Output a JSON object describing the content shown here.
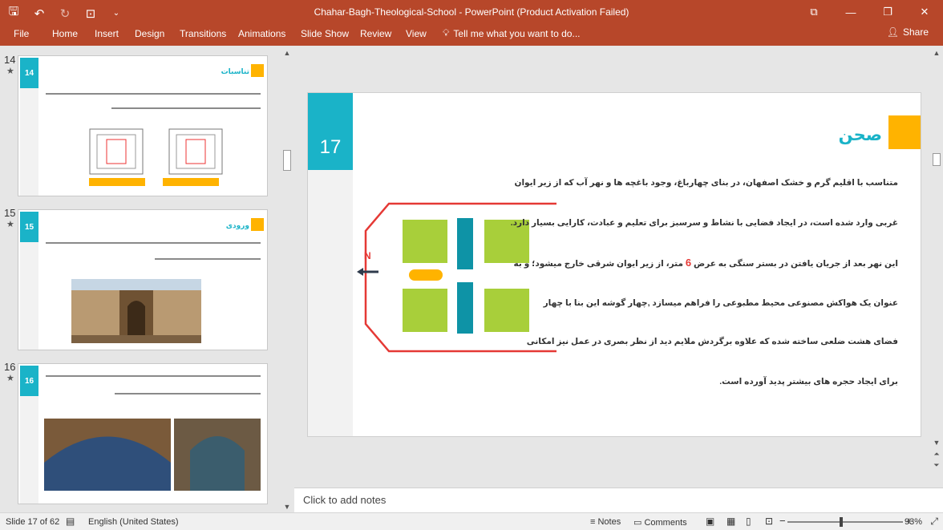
{
  "window": {
    "title": "Chahar-Bagh-Theological-School  -  PowerPoint (Product Activation Failed)",
    "icons": [
      "save-icon",
      "undo-icon",
      "redo-icon",
      "present-icon",
      "restore-icon",
      "minimize-icon",
      "maximize-icon",
      "close-icon"
    ]
  },
  "ribbon": {
    "tabs": [
      "File",
      "Home",
      "Insert",
      "Design",
      "Transitions",
      "Animations",
      "Slide Show",
      "Review",
      "View"
    ],
    "tell_me": "Tell me what you want to do...",
    "share": "Share"
  },
  "thumbnails": [
    {
      "number": "14",
      "badge": "14",
      "title": "تناسبات"
    },
    {
      "number": "15",
      "badge": "15",
      "title": "ورودی"
    },
    {
      "number": "16",
      "badge": "16",
      "title": ""
    }
  ],
  "slide": {
    "number": "17",
    "heading": "صحن",
    "north_label": "N",
    "colors": {
      "teal": "#1ab3c8",
      "yellow": "#ffb300",
      "green": "#a8cf3a",
      "red": "#e53935"
    },
    "paragraph": [
      "متناسب با اقلیم گرم و خشک اصفهان، در بنای چهارباغ، وجود باغچه ها و نهر آب که از زیر ایوان",
      "غربی وارد شده است، در ایجاد فضایی با نشاط و سرسبز برای تعلیم و عبادت، کارایی بسیار دارد.",
      {
        "before": "این نهر بعد از جریان یافتن در بستر سنگی به عرض ",
        "highlight": "6",
        "after": " متر، از زیر ایوان شرقی خارج میشود؛ و به"
      },
      "عنوان یک هواکش مصنوعی محیط مطبوعی را فراهم میسازد ,چهار گوشه این بنا با چهار",
      "فضای هشت ضلعی ساخته شده که علاوه برگردش ملایم دید از نظر بصری در عمل نیز امکانی",
      "برای ایجاد حجره های بیشتر پدید آورده است."
    ]
  },
  "notes": {
    "placeholder": "Click to add notes"
  },
  "status": {
    "slide_info": "Slide 17 of 62",
    "language": "English (United States)",
    "notes": "Notes",
    "comments": "Comments",
    "zoom": "93%",
    "zoom_level": 0.93
  }
}
